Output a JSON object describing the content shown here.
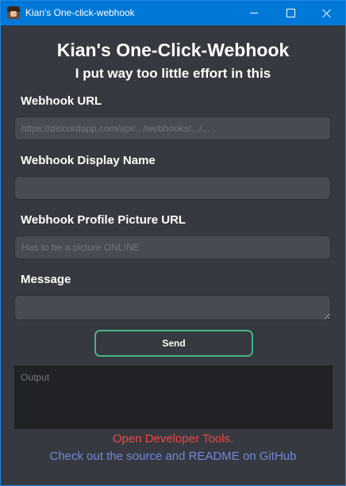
{
  "window": {
    "title": "Kian's One-click-webhook",
    "buttons": {
      "minimize_icon": "minimize-icon",
      "maximize_icon": "maximize-icon",
      "close_icon": "close-icon"
    }
  },
  "header": {
    "title": "Kian's One-Click-Webhook",
    "subtitle": "I put way too little effort in this"
  },
  "form": {
    "webhook_url": {
      "label": "Webhook URL",
      "value": "",
      "placeholder": "https://discordapp.com/api/.../webhooks/.../..."
    },
    "display_name": {
      "label": "Webhook Display Name",
      "value": "",
      "placeholder": ""
    },
    "avatar_url": {
      "label": "Webhook Profile Picture URL",
      "value": "",
      "placeholder": "Has to be a picture ONLINE"
    },
    "message": {
      "label": "Message",
      "value": "",
      "placeholder": ""
    },
    "send_label": "Send"
  },
  "output": {
    "value": "",
    "placeholder": "Output"
  },
  "footer": {
    "devtools_label": "Open Developer Tools.",
    "github_label": "Check out the source and README on GitHub"
  },
  "colors": {
    "background": "#36393f",
    "input_bg": "#484b52",
    "output_bg": "#202225",
    "titlebar": "#0078d7",
    "send_border": "#43b581",
    "devtools_link": "#f04747",
    "github_link": "#7289da"
  }
}
